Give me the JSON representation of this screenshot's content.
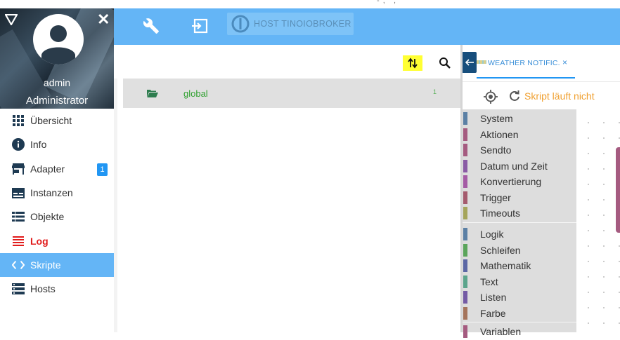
{
  "top_fragment": "- ; ' ;",
  "profile": {
    "username": "admin",
    "role": "Administrator"
  },
  "menu": [
    {
      "label": "Übersicht",
      "icon": "grid-icon"
    },
    {
      "label": "Info",
      "icon": "info-icon"
    },
    {
      "label": "Adapter",
      "icon": "store-icon",
      "badge": "1"
    },
    {
      "label": "Instanzen",
      "icon": "instances-icon"
    },
    {
      "label": "Objekte",
      "icon": "list-icon"
    },
    {
      "label": "Log",
      "icon": "log-icon"
    },
    {
      "label": "Skripte",
      "icon": "code-icon",
      "active": true
    },
    {
      "label": "Hosts",
      "icon": "hosts-icon"
    }
  ],
  "host": {
    "label": "HOST TINOIOBROKER"
  },
  "scripts": [
    {
      "name": "global",
      "count": "1"
    }
  ],
  "editor": {
    "tab_label": "WEATHER NOTIFIC.",
    "tab_close": "×",
    "status": "Skript läuft nicht"
  },
  "blockly_categories": [
    {
      "label": "System",
      "color": "#5b80a5"
    },
    {
      "label": "Aktionen",
      "color": "#a55b80"
    },
    {
      "label": "Sendto",
      "color": "#a55b80"
    },
    {
      "label": "Datum und Zeit",
      "color": "#8a5ba5"
    },
    {
      "label": "Konvertierung",
      "color": "#a55ba5"
    },
    {
      "label": "Trigger",
      "color": "#a55b6e"
    },
    {
      "label": "Timeouts",
      "color": "#a5a55b"
    },
    {
      "label": "Logik",
      "color": "#5b80a5"
    },
    {
      "label": "Schleifen",
      "color": "#5ba55b"
    },
    {
      "label": "Mathematik",
      "color": "#5b67a5"
    },
    {
      "label": "Text",
      "color": "#5ba58c"
    },
    {
      "label": "Listen",
      "color": "#745ba5"
    },
    {
      "label": "Farbe",
      "color": "#a5745b"
    },
    {
      "label": "Variablen",
      "color": "#a55b80"
    }
  ],
  "colors": {
    "accent": "#64b5f6",
    "active_menu": "#64b5f6",
    "log_red": "#e11b1b",
    "status_orange": "#f0a030",
    "folder_green": "#2fa02f",
    "highlight": "#ffff33"
  }
}
